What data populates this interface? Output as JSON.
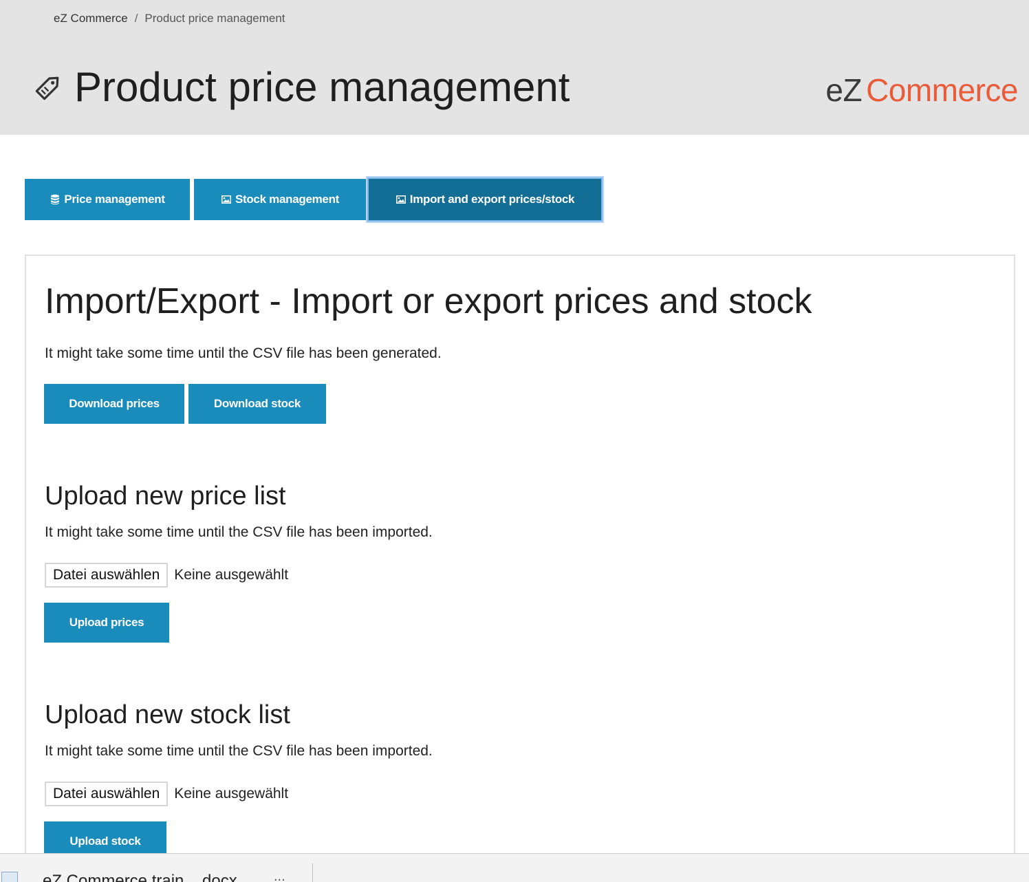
{
  "breadcrumb": {
    "root": "eZ Commerce",
    "separator": "/",
    "current": "Product price management"
  },
  "header": {
    "title": "Product price management",
    "title_icon": "price-tag-icon",
    "logo_ez": "eZ",
    "logo_commerce": "Commerce"
  },
  "tabs": [
    {
      "label": "Price management",
      "icon": "database-icon",
      "active": false
    },
    {
      "label": "Stock management",
      "icon": "image-icon",
      "active": false
    },
    {
      "label": "Import and export prices/stock",
      "icon": "image-icon",
      "active": true
    }
  ],
  "main": {
    "title": "Import/Export - Import or export prices and stock",
    "export_note": "It might take some time until the CSV file has been generated.",
    "download_prices": "Download prices",
    "download_stock": "Download stock",
    "price_section": {
      "title": "Upload new price list",
      "note": "It might take some time until the CSV file has been imported.",
      "file_button": "Datei auswählen",
      "file_status": "Keine ausgewählt",
      "upload_button": "Upload prices"
    },
    "stock_section": {
      "title": "Upload new stock list",
      "note": "It might take some time until the CSV file has been imported.",
      "file_button": "Datei auswählen",
      "file_status": "Keine ausgewählt",
      "upload_button": "Upload stock"
    }
  },
  "downloads_bar": {
    "file_name": "eZ Commerce train....docx",
    "menu": "..."
  },
  "colors": {
    "header_bg": "#e5e4e5",
    "button_blue": "#1a8cbb",
    "active_tab": "#136e96",
    "logo_orange": "#ea5b3a"
  }
}
